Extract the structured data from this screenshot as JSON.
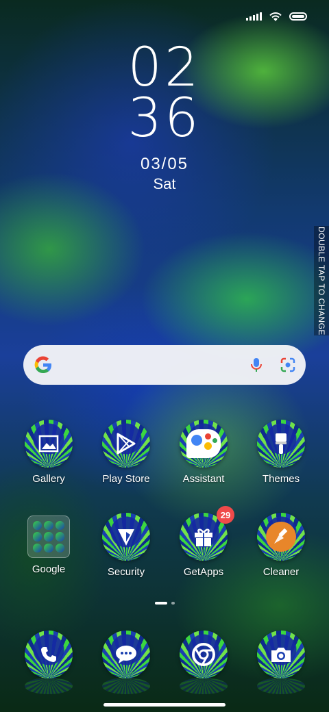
{
  "status_bar": {
    "signal": "signal-icon",
    "wifi": "wifi-icon",
    "battery": "battery-icon"
  },
  "clock": {
    "hours": "02",
    "minutes": "36",
    "date": "03/05",
    "day": "Sat"
  },
  "side_tab": {
    "label": "DOUBLE TAP TO CHANGE"
  },
  "search": {
    "logo": "google-g-icon",
    "mic": "mic-icon",
    "lens": "lens-icon"
  },
  "apps_row1": [
    {
      "label": "Gallery",
      "icon": "gallery-icon"
    },
    {
      "label": "Play Store",
      "icon": "play-store-icon"
    },
    {
      "label": "Assistant",
      "icon": "assistant-icon"
    },
    {
      "label": "Themes",
      "icon": "themes-brush-icon"
    }
  ],
  "apps_row2": [
    {
      "label": "Google",
      "icon": "folder-icon"
    },
    {
      "label": "Security",
      "icon": "security-icon"
    },
    {
      "label": "GetApps",
      "icon": "gift-icon",
      "badge": "29"
    },
    {
      "label": "Cleaner",
      "icon": "cleaner-brush-icon"
    }
  ],
  "dock": [
    {
      "icon": "phone-icon"
    },
    {
      "icon": "messages-icon"
    },
    {
      "icon": "chrome-icon"
    },
    {
      "icon": "camera-icon"
    }
  ],
  "pager": {
    "pages": 2,
    "current": 1
  }
}
